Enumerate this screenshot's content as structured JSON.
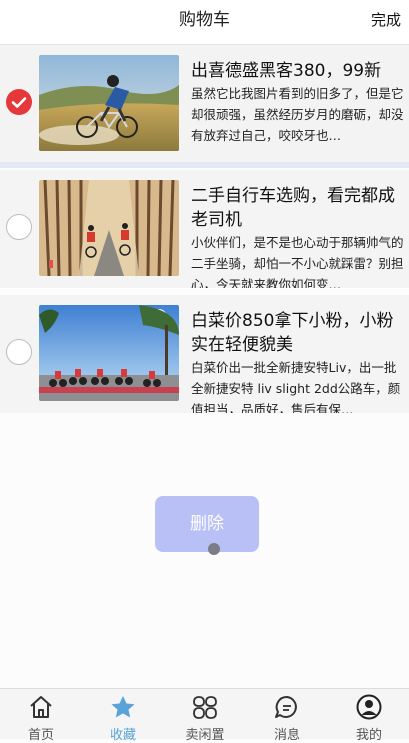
{
  "header": {
    "title": "购物车",
    "done_label": "完成"
  },
  "items": [
    {
      "checked": true,
      "name": "出喜德盛黑客380，99新",
      "desc": "虽然它比我图片看到的旧多了，但是它却很顽强，虽然经历岁月的磨砺，却没有放弃过自己，咬咬牙也…"
    },
    {
      "checked": false,
      "name": "二手自行车选购，看完都成老司机",
      "desc": "小伙伴们，是不是也心动于那辆帅气的二手坐骑，却怕一不小心就踩雷？别担心，今天就来教你如何变…"
    },
    {
      "checked": false,
      "name": "白菜价850拿下小粉，小粉实在轻便貌美",
      "desc": "白菜价出一批全新捷安特Liv，出一批全新捷安特 liv slight 2dd公路车，颜值担当，品质好，售后有保…"
    }
  ],
  "actions": {
    "delete_label": "删除"
  },
  "tabbar": [
    {
      "label": "首页",
      "icon": "home-icon",
      "active": false
    },
    {
      "label": "收藏",
      "icon": "star-icon",
      "active": true
    },
    {
      "label": "卖闲置",
      "icon": "grid-icon",
      "active": false
    },
    {
      "label": "消息",
      "icon": "message-icon",
      "active": false
    },
    {
      "label": "我的",
      "icon": "user-icon",
      "active": false
    }
  ],
  "colors": {
    "accent_red": "#e5383b",
    "tab_active": "#5aa3d8",
    "delete_bg": "#b8c0f5"
  }
}
